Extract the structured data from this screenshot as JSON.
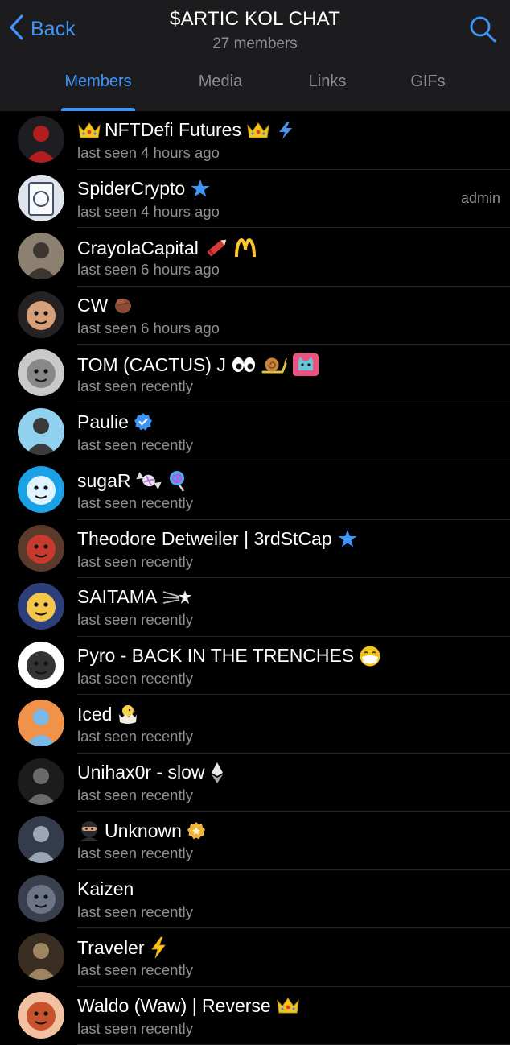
{
  "header": {
    "back_label": "Back",
    "title": "$ARTIC KOL CHAT",
    "subtitle": "27 members"
  },
  "tabs": [
    {
      "label": "Members",
      "active": true
    },
    {
      "label": "Media"
    },
    {
      "label": "Links"
    },
    {
      "label": "GIFs"
    }
  ],
  "colors": {
    "accent": "#3e95f6",
    "header_bg": "#1c1c1e",
    "muted": "#8e8e93"
  },
  "members": [
    {
      "name": "NFTDefi Futures",
      "status": "last seen 4 hours ago",
      "role": "",
      "icons": [
        "crown-icon",
        "crown-icon",
        "lightning-icon"
      ]
    },
    {
      "name": "SpiderCrypto",
      "status": "last seen 4 hours ago",
      "role": "admin",
      "icons": [
        "star-icon"
      ]
    },
    {
      "name": "CrayolaCapital",
      "status": "last seen 6 hours ago",
      "role": "",
      "icons": [
        "crayon-icon",
        "mcdonalds-icon"
      ]
    },
    {
      "name": "CW",
      "status": "last seen 6 hours ago",
      "role": "",
      "icons": [
        "hand-icon"
      ]
    },
    {
      "name": "TOM (CACTUS) J",
      "status": "last seen recently",
      "role": "",
      "icons": [
        "eyes-icon",
        "snail-icon",
        "cat-icon"
      ]
    },
    {
      "name": "Paulie",
      "status": "last seen recently",
      "role": "",
      "icons": [
        "verified-icon"
      ]
    },
    {
      "name": "sugaR",
      "status": "last seen recently",
      "role": "",
      "icons": [
        "candy-icon",
        "lollipop-icon"
      ]
    },
    {
      "name": "Theodore Detweiler | 3rdStCap",
      "status": "last seen recently",
      "role": "",
      "icons": [
        "star-icon"
      ]
    },
    {
      "name": "SAITAMA",
      "status": "last seen recently",
      "role": "",
      "icons": [
        "shooting-star-icon"
      ]
    },
    {
      "name": "Pyro - BACK IN THE TRENCHES",
      "status": "last seen recently",
      "role": "",
      "icons": [
        "mask-face-icon"
      ]
    },
    {
      "name": "Iced",
      "status": "last seen recently",
      "role": "",
      "icons": [
        "hatching-chick-icon"
      ]
    },
    {
      "name": "Unihax0r - slow",
      "status": "last seen recently",
      "role": "",
      "icons": [
        "ethereum-icon"
      ]
    },
    {
      "name": "Unknown",
      "status": "last seen recently",
      "role": "",
      "icons": [
        "ninja-icon",
        "gold-badge-icon"
      ]
    },
    {
      "name": "Kaizen",
      "status": "last seen recently",
      "role": "",
      "icons": []
    },
    {
      "name": "Traveler",
      "status": "last seen recently",
      "role": "",
      "icons": [
        "lightning-bolt-icon"
      ]
    },
    {
      "name": "Waldo (Waw) | Reverse",
      "status": "last seen recently",
      "role": "",
      "icons": [
        "crown-icon"
      ]
    }
  ]
}
